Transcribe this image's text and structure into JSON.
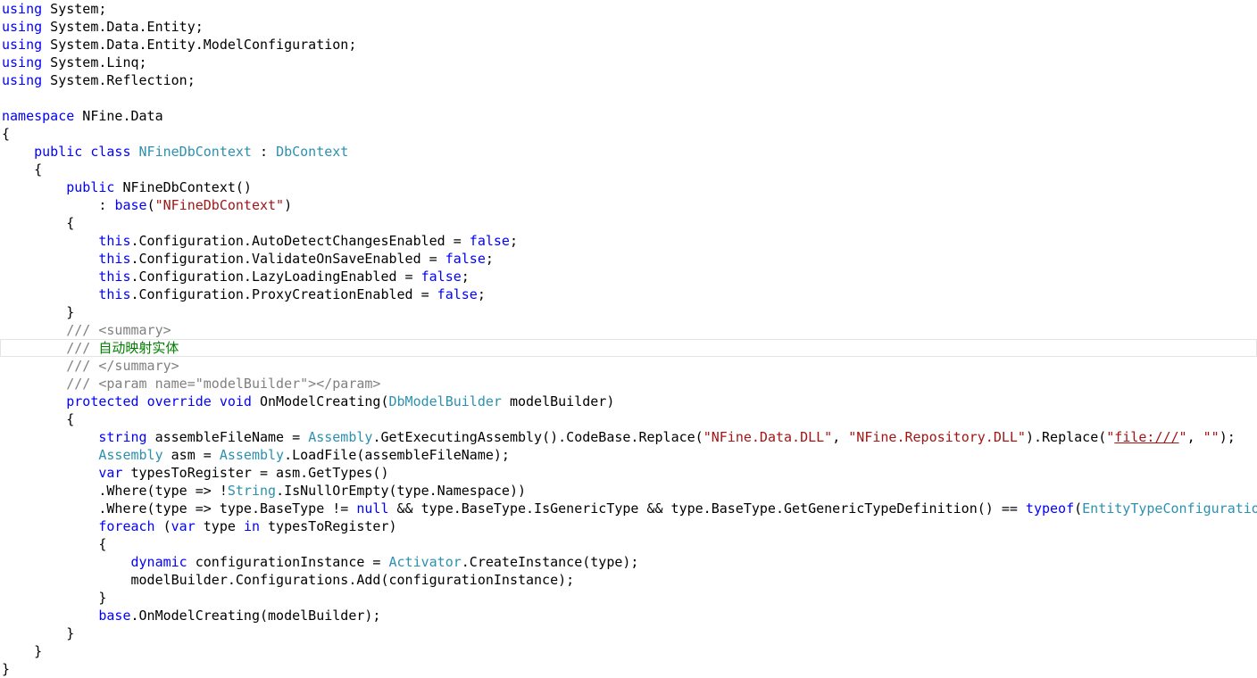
{
  "colors": {
    "background": "#ffffff",
    "keyword": "#0000ff",
    "type": "#2b91af",
    "string": "#a31515",
    "comment": "#008000",
    "doc": "#808080",
    "plain": "#000000"
  },
  "editor": {
    "current_line": 19,
    "lines": [
      [
        {
          "t": "kw",
          "v": "using"
        },
        {
          "t": "p",
          "v": " System;"
        }
      ],
      [
        {
          "t": "kw",
          "v": "using"
        },
        {
          "t": "p",
          "v": " System.Data.Entity;"
        }
      ],
      [
        {
          "t": "kw",
          "v": "using"
        },
        {
          "t": "p",
          "v": " System.Data.Entity.ModelConfiguration;"
        }
      ],
      [
        {
          "t": "kw",
          "v": "using"
        },
        {
          "t": "p",
          "v": " System.Linq;"
        }
      ],
      [
        {
          "t": "kw",
          "v": "using"
        },
        {
          "t": "p",
          "v": " System.Reflection;"
        }
      ],
      [],
      [
        {
          "t": "kw",
          "v": "namespace"
        },
        {
          "t": "p",
          "v": " NFine.Data"
        }
      ],
      [
        {
          "t": "p",
          "v": "{"
        }
      ],
      [
        {
          "t": "p",
          "v": "    "
        },
        {
          "t": "kw",
          "v": "public"
        },
        {
          "t": "p",
          "v": " "
        },
        {
          "t": "kw",
          "v": "class"
        },
        {
          "t": "p",
          "v": " "
        },
        {
          "t": "ty",
          "v": "NFineDbContext"
        },
        {
          "t": "p",
          "v": " : "
        },
        {
          "t": "ty",
          "v": "DbContext"
        }
      ],
      [
        {
          "t": "p",
          "v": "    {"
        }
      ],
      [
        {
          "t": "p",
          "v": "        "
        },
        {
          "t": "kw",
          "v": "public"
        },
        {
          "t": "p",
          "v": " NFineDbContext()"
        }
      ],
      [
        {
          "t": "p",
          "v": "            : "
        },
        {
          "t": "kw",
          "v": "base"
        },
        {
          "t": "p",
          "v": "("
        },
        {
          "t": "str",
          "v": "\"NFineDbContext\""
        },
        {
          "t": "p",
          "v": ")"
        }
      ],
      [
        {
          "t": "p",
          "v": "        {"
        }
      ],
      [
        {
          "t": "p",
          "v": "            "
        },
        {
          "t": "kw",
          "v": "this"
        },
        {
          "t": "p",
          "v": ".Configuration.AutoDetectChangesEnabled = "
        },
        {
          "t": "kw",
          "v": "false"
        },
        {
          "t": "p",
          "v": ";"
        }
      ],
      [
        {
          "t": "p",
          "v": "            "
        },
        {
          "t": "kw",
          "v": "this"
        },
        {
          "t": "p",
          "v": ".Configuration.ValidateOnSaveEnabled = "
        },
        {
          "t": "kw",
          "v": "false"
        },
        {
          "t": "p",
          "v": ";"
        }
      ],
      [
        {
          "t": "p",
          "v": "            "
        },
        {
          "t": "kw",
          "v": "this"
        },
        {
          "t": "p",
          "v": ".Configuration.LazyLoadingEnabled = "
        },
        {
          "t": "kw",
          "v": "false"
        },
        {
          "t": "p",
          "v": ";"
        }
      ],
      [
        {
          "t": "p",
          "v": "            "
        },
        {
          "t": "kw",
          "v": "this"
        },
        {
          "t": "p",
          "v": ".Configuration.ProxyCreationEnabled = "
        },
        {
          "t": "kw",
          "v": "false"
        },
        {
          "t": "p",
          "v": ";"
        }
      ],
      [
        {
          "t": "p",
          "v": "        }"
        }
      ],
      [
        {
          "t": "p",
          "v": "        "
        },
        {
          "t": "doc",
          "v": "/// <summary>"
        }
      ],
      [
        {
          "t": "p",
          "v": "        "
        },
        {
          "t": "doc",
          "v": "/// "
        },
        {
          "t": "cm",
          "v": "自动映射实体"
        }
      ],
      [
        {
          "t": "p",
          "v": "        "
        },
        {
          "t": "doc",
          "v": "/// </summary>"
        }
      ],
      [
        {
          "t": "p",
          "v": "        "
        },
        {
          "t": "doc",
          "v": "/// <param name=\"modelBuilder\"></param>"
        }
      ],
      [
        {
          "t": "p",
          "v": "        "
        },
        {
          "t": "kw",
          "v": "protected"
        },
        {
          "t": "p",
          "v": " "
        },
        {
          "t": "kw",
          "v": "override"
        },
        {
          "t": "p",
          "v": " "
        },
        {
          "t": "kw",
          "v": "void"
        },
        {
          "t": "p",
          "v": " OnModelCreating("
        },
        {
          "t": "ty",
          "v": "DbModelBuilder"
        },
        {
          "t": "p",
          "v": " modelBuilder)"
        }
      ],
      [
        {
          "t": "p",
          "v": "        {"
        }
      ],
      [
        {
          "t": "p",
          "v": "            "
        },
        {
          "t": "kw",
          "v": "string"
        },
        {
          "t": "p",
          "v": " assembleFileName = "
        },
        {
          "t": "ty",
          "v": "Assembly"
        },
        {
          "t": "p",
          "v": ".GetExecutingAssembly().CodeBase.Replace("
        },
        {
          "t": "str",
          "v": "\"NFine.Data.DLL\""
        },
        {
          "t": "p",
          "v": ", "
        },
        {
          "t": "str",
          "v": "\"NFine.Repository.DLL\""
        },
        {
          "t": "p",
          "v": ").Replace("
        },
        {
          "t": "str",
          "v": "\""
        },
        {
          "t": "link",
          "v": "file:///"
        },
        {
          "t": "str",
          "v": "\""
        },
        {
          "t": "p",
          "v": ", "
        },
        {
          "t": "str",
          "v": "\"\""
        },
        {
          "t": "p",
          "v": ");"
        }
      ],
      [
        {
          "t": "p",
          "v": "            "
        },
        {
          "t": "ty",
          "v": "Assembly"
        },
        {
          "t": "p",
          "v": " asm = "
        },
        {
          "t": "ty",
          "v": "Assembly"
        },
        {
          "t": "p",
          "v": ".LoadFile(assembleFileName);"
        }
      ],
      [
        {
          "t": "p",
          "v": "            "
        },
        {
          "t": "kw",
          "v": "var"
        },
        {
          "t": "p",
          "v": " typesToRegister = asm.GetTypes()"
        }
      ],
      [
        {
          "t": "p",
          "v": "            .Where(type => !"
        },
        {
          "t": "ty",
          "v": "String"
        },
        {
          "t": "p",
          "v": ".IsNullOrEmpty(type.Namespace))"
        }
      ],
      [
        {
          "t": "p",
          "v": "            .Where(type => type.BaseType != "
        },
        {
          "t": "kw",
          "v": "null"
        },
        {
          "t": "p",
          "v": " && type.BaseType.IsGenericType && type.BaseType.GetGenericTypeDefinition() == "
        },
        {
          "t": "kw",
          "v": "typeof"
        },
        {
          "t": "p",
          "v": "("
        },
        {
          "t": "ty",
          "v": "EntityTypeConfiguratio"
        }
      ],
      [
        {
          "t": "p",
          "v": "            "
        },
        {
          "t": "kw",
          "v": "foreach"
        },
        {
          "t": "p",
          "v": " ("
        },
        {
          "t": "kw",
          "v": "var"
        },
        {
          "t": "p",
          "v": " type "
        },
        {
          "t": "kw",
          "v": "in"
        },
        {
          "t": "p",
          "v": " typesToRegister)"
        }
      ],
      [
        {
          "t": "p",
          "v": "            {"
        }
      ],
      [
        {
          "t": "p",
          "v": "                "
        },
        {
          "t": "kw",
          "v": "dynamic"
        },
        {
          "t": "p",
          "v": " configurationInstance = "
        },
        {
          "t": "ty",
          "v": "Activator"
        },
        {
          "t": "p",
          "v": ".CreateInstance(type);"
        }
      ],
      [
        {
          "t": "p",
          "v": "                modelBuilder.Configurations.Add(configurationInstance);"
        }
      ],
      [
        {
          "t": "p",
          "v": "            }"
        }
      ],
      [
        {
          "t": "p",
          "v": "            "
        },
        {
          "t": "kw",
          "v": "base"
        },
        {
          "t": "p",
          "v": ".OnModelCreating(modelBuilder);"
        }
      ],
      [
        {
          "t": "p",
          "v": "        }"
        }
      ],
      [
        {
          "t": "p",
          "v": "    }"
        }
      ],
      [
        {
          "t": "p",
          "v": "}"
        }
      ]
    ]
  }
}
